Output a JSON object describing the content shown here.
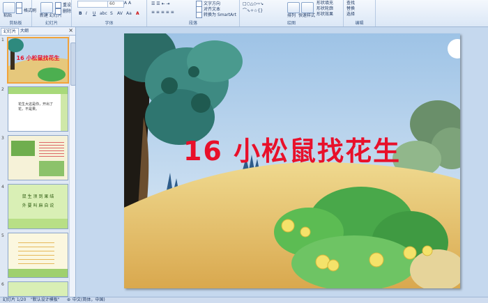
{
  "ribbon": {
    "groups": [
      {
        "label": "剪贴板"
      },
      {
        "label": "幻灯片"
      },
      {
        "label": "字体"
      },
      {
        "label": "段落"
      },
      {
        "label": "绘图"
      },
      {
        "label": "编辑"
      }
    ],
    "clipboard": {
      "paste": "粘贴",
      "format_painter": "格式刷"
    },
    "slides": {
      "new_slide": "新建\n幻灯片",
      "reset": "重设",
      "delete": "删除"
    },
    "font": {
      "size": "60"
    },
    "paragraph": {
      "text_direction": "文字方向",
      "align_text": "对齐文本",
      "smartart": "转换为 SmartArt"
    },
    "drawing": {
      "arrange": "排列",
      "quick_styles": "快速样式",
      "shape_fill": "形状填充",
      "shape_outline": "形状轮廓",
      "shape_effects": "形状效果"
    },
    "editing": {
      "find": "查找",
      "replace": "替换",
      "select": "选择"
    }
  },
  "pane": {
    "tabs": [
      "幻灯片",
      "大纲"
    ],
    "thumbnails": [
      {
        "num": "1",
        "title": "16 小松鼠找花生"
      },
      {
        "num": "2",
        "text": "花生大这是你，开出了花，不是果。"
      },
      {
        "num": "3"
      },
      {
        "num": "4",
        "words": [
          "鼠 生 须 到 果 结",
          "外 要 叫 麻 自 说"
        ]
      },
      {
        "num": "5"
      },
      {
        "num": "6"
      }
    ]
  },
  "slide": {
    "title": "16 小松鼠找花生"
  },
  "status": {
    "slide_counter": "幻灯片 1/20",
    "theme": "\"默认设计模板\"",
    "language": "中文(简体，中国)"
  },
  "colors": {
    "title": "#e8102a",
    "sky": "#bcd5ee",
    "hill": "#e6c87c",
    "selection": "#f2a33a"
  }
}
